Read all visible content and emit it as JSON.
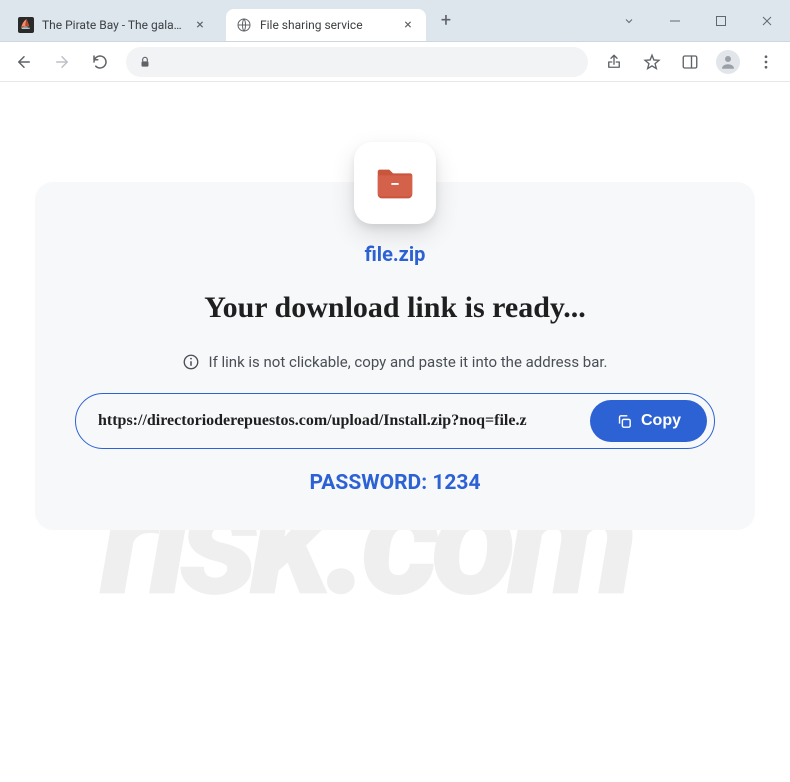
{
  "window": {
    "tabs": [
      {
        "title": "The Pirate Bay - The galaxy's mos...",
        "active": false
      },
      {
        "title": "File sharing service",
        "active": true
      }
    ]
  },
  "page": {
    "filename": "file.zip",
    "headline": "Your download link is ready...",
    "hint": "If link is not clickable, copy and paste it into the address bar.",
    "url": "https://directorioderepuestos.com/upload/Install.zip?noq=file.z",
    "copy_label": "Copy",
    "password_label": "PASSWORD: 1234"
  },
  "colors": {
    "accent": "#2d62d4"
  },
  "icons": {
    "folder": "folder-icon",
    "globe": "globe-icon",
    "info": "info-icon",
    "copy": "copy-icon"
  }
}
